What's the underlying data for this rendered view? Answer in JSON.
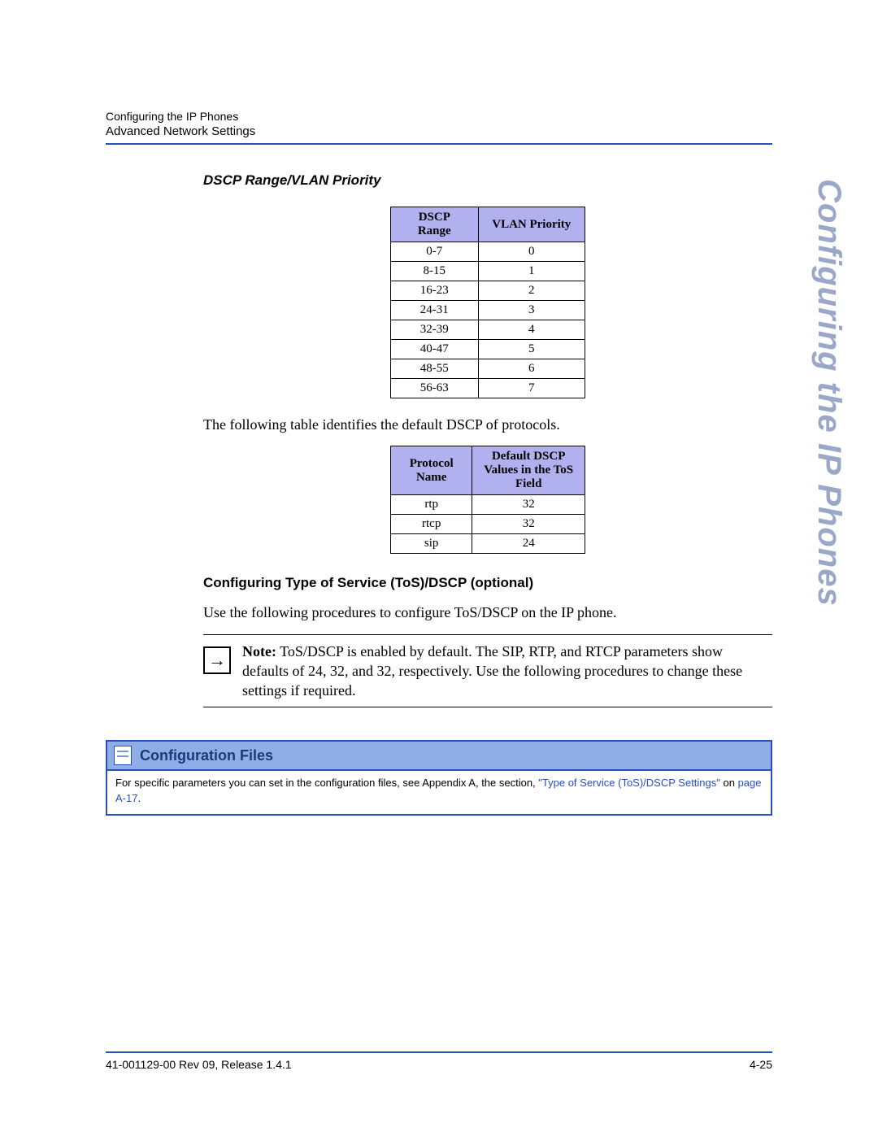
{
  "header": {
    "line1": "Configuring the IP Phones",
    "line2": "Advanced Network Settings"
  },
  "side_title": "Configuring the IP Phones",
  "section1_title": "DSCP Range/VLAN Priority",
  "table1": {
    "head_col1": "DSCP Range",
    "head_col2": "VLAN Priority",
    "rows": [
      {
        "r": "0-7",
        "p": "0"
      },
      {
        "r": "8-15",
        "p": "1"
      },
      {
        "r": "16-23",
        "p": "2"
      },
      {
        "r": "24-31",
        "p": "3"
      },
      {
        "r": "32-39",
        "p": "4"
      },
      {
        "r": "40-47",
        "p": "5"
      },
      {
        "r": "48-55",
        "p": "6"
      },
      {
        "r": "56-63",
        "p": "7"
      }
    ]
  },
  "para1": "The following table identifies the default DSCP of protocols.",
  "table2": {
    "head_col1": "Protocol Name",
    "head_col2": "Default DSCP Values in the ToS Field",
    "rows": [
      {
        "n": "rtp",
        "v": "32"
      },
      {
        "n": "rtcp",
        "v": "32"
      },
      {
        "n": "sip",
        "v": "24"
      }
    ]
  },
  "section2_title": "Configuring Type of Service (ToS)/DSCP (optional)",
  "para2": "Use the following procedures to configure ToS/DSCP on the IP phone.",
  "note": {
    "label": "Note:",
    "body": " ToS/DSCP is enabled by default. The SIP, RTP, and RTCP parameters show defaults of 24, 32, and 32, respectively. Use the following procedures to change these settings if required."
  },
  "config": {
    "title": "Configuration Files",
    "body_pre": "For specific parameters you can set in the configuration files, see Appendix A, the section, ",
    "link1": "\"Type of Service (ToS)/DSCP Settings\"",
    "body_mid": " on ",
    "link2": "page A-17",
    "body_post": "."
  },
  "footer": {
    "left": "41-001129-00 Rev 09, Release 1.4.1",
    "right": "4-25"
  }
}
